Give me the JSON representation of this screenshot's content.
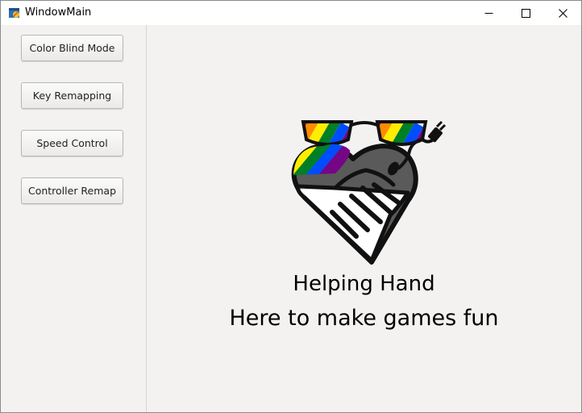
{
  "window": {
    "title": "WindowMain"
  },
  "titlebar_icons": [
    "app-icon",
    "minimize-icon",
    "maximize-icon",
    "close-icon"
  ],
  "sidebar": {
    "buttons": [
      {
        "label": "Color Blind Mode"
      },
      {
        "label": "Key Remapping"
      },
      {
        "label": "Speed Control"
      },
      {
        "label": "Controller Remap"
      }
    ]
  },
  "main": {
    "logo_icon": "heart-handshake-rainbow-glasses-logo",
    "headline": "Helping Hand",
    "tagline": "Here to make games fun"
  },
  "colors": {
    "rainbow": [
      "#e40303",
      "#ff8c00",
      "#ffed00",
      "#008026",
      "#004dff",
      "#750787"
    ],
    "heart_dark": "#5a5a5a",
    "background": "#f3f2f1"
  }
}
